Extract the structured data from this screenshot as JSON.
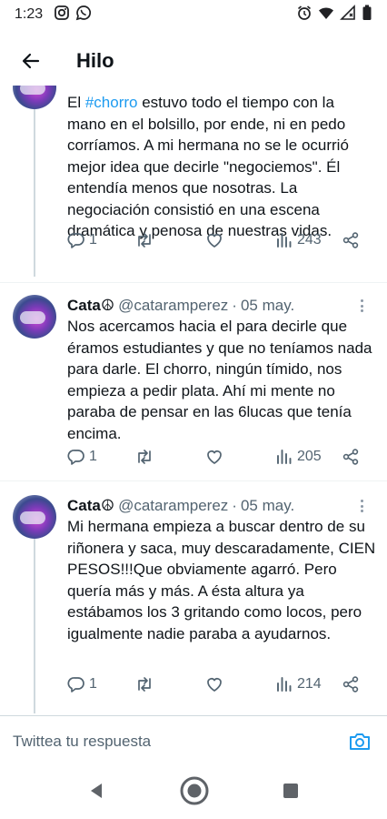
{
  "status_bar": {
    "time": "1:23"
  },
  "header": {
    "title": "Hilo"
  },
  "tweets": [
    {
      "text_pre": "El ",
      "hashtag": "#chorro",
      "text_post": " estuvo todo el tiempo con la mano en el bolsillo, por ende, ni en pedo corríamos. A mi hermana no se le ocurrió mejor idea que decirle \"negociemos\". Él entendía menos que nosotras. La negociación consistió en una escena dramática y penosa de nuestras vidas.",
      "replies": "1",
      "views": "243"
    },
    {
      "author_name": "Cata☮",
      "author_handle": "@cataramperez",
      "separator": "·",
      "date": "05 may.",
      "text": "Nos acercamos hacia el para decirle que éramos estudiantes y que no teníamos nada para darle. El chorro, ningún tímido, nos empieza a pedir plata. Ahí mi mente no paraba de pensar en las 6lucas que tenía encima.",
      "replies": "1",
      "views": "205"
    },
    {
      "author_name": "Cata☮",
      "author_handle": "@cataramperez",
      "separator": "·",
      "date": "05 may.",
      "text": "Mi hermana empieza a buscar dentro de su riñonera y saca, muy descaradamente, CIEN PESOS!!!Que obviamente agarró. Pero quería más y más. A ésta altura ya estábamos los 3 gritando como locos, pero igualmente nadie paraba a ayudarnos.",
      "replies": "1",
      "views": "214"
    }
  ],
  "reply_bar": {
    "placeholder": "Twittea tu respuesta"
  },
  "icons": {
    "status_left": [
      "instagram-icon",
      "whatsapp-icon"
    ],
    "status_right": [
      "alarm-icon",
      "wifi-icon",
      "signal-icon",
      "battery-icon"
    ],
    "actions": [
      "reply-icon",
      "retweet-icon",
      "like-icon",
      "views-icon",
      "share-icon"
    ],
    "nav": [
      "back-triangle-icon",
      "home-circle-icon",
      "recents-square-icon"
    ]
  },
  "colors": {
    "accent": "#1d9bf0",
    "text": "#0f1419",
    "secondary": "#536471",
    "divider": "#cfd9de"
  }
}
